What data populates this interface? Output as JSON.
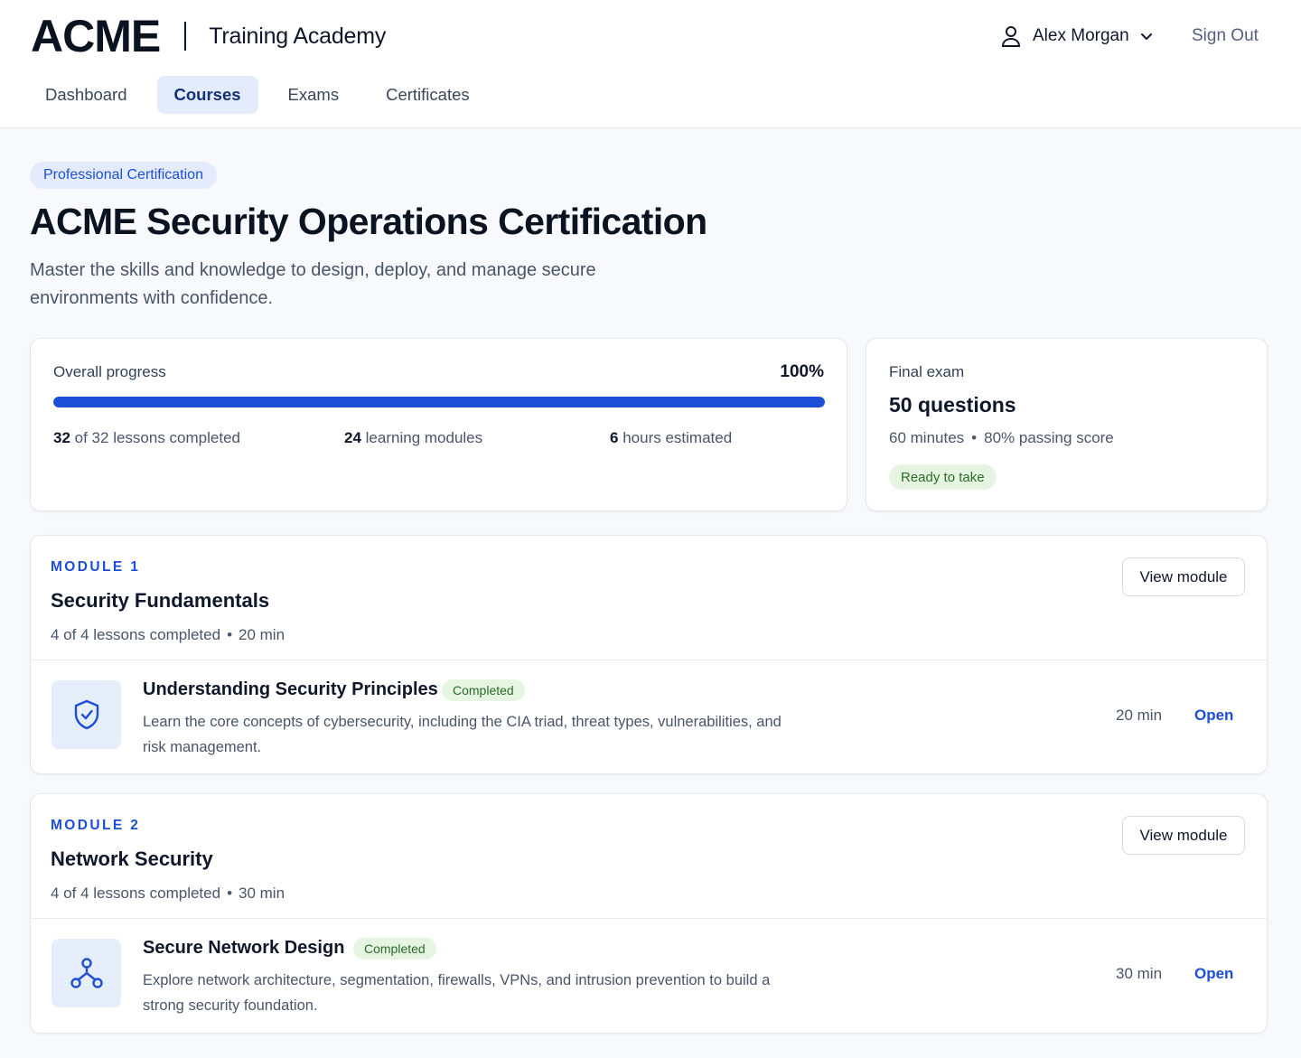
{
  "header": {
    "logo": "ACME",
    "subtitle": "Training Academy",
    "user_name": "Alex Morgan",
    "sign_out": "Sign Out"
  },
  "nav": {
    "tabs": [
      {
        "label": "Dashboard",
        "active": false
      },
      {
        "label": "Courses",
        "active": true
      },
      {
        "label": "Exams",
        "active": false
      },
      {
        "label": "Certificates",
        "active": false
      }
    ]
  },
  "hero": {
    "badge": "Professional Certification",
    "title": "ACME Security Operations Certification",
    "description": "Master the skills and knowledge to design, deploy, and manage secure environments with confidence."
  },
  "progress": {
    "label": "Overall progress",
    "percent_text": "100%",
    "percent": 100,
    "lessons_count": "32",
    "lessons_text": "of 32 lessons completed",
    "modules_count": "24",
    "modules_text": "learning modules",
    "hours_count": "6",
    "hours_text": "hours estimated"
  },
  "exam": {
    "label": "Final exam",
    "questions": "50 questions",
    "duration": "60 minutes",
    "separator": "•",
    "passing": "80% passing score",
    "status": "Ready to take"
  },
  "modules": [
    {
      "tag": "MODULE 1",
      "title": "Security Fundamentals",
      "lessons": "4 of 4 lessons completed",
      "separator": "•",
      "duration": "20 min",
      "view_label": "View module",
      "lesson": {
        "icon": "shield-check-icon",
        "title": "Understanding Security Principles",
        "status": "Completed",
        "description": "Learn the core concepts of cybersecurity, including the CIA triad, threat types, vulnerabilities, and risk management.",
        "duration": "20 min",
        "open_label": "Open"
      }
    },
    {
      "tag": "MODULE 2",
      "title": "Network Security",
      "lessons": "4 of 4 lessons completed",
      "separator": "•",
      "duration": "30 min",
      "view_label": "View module",
      "lesson": {
        "icon": "network-icon",
        "title": "Secure Network Design",
        "status": "Completed",
        "description": "Explore network architecture, segmentation, firewalls, VPNs, and intrusion prevention to build a strong security foundation.",
        "duration": "30 min",
        "open_label": "Open"
      }
    }
  ],
  "colors": {
    "accent": "#1d4ed8",
    "success_bg": "#e6f4e2",
    "success_text": "#2a6b27",
    "tab_active_bg": "#e4ecfb"
  }
}
